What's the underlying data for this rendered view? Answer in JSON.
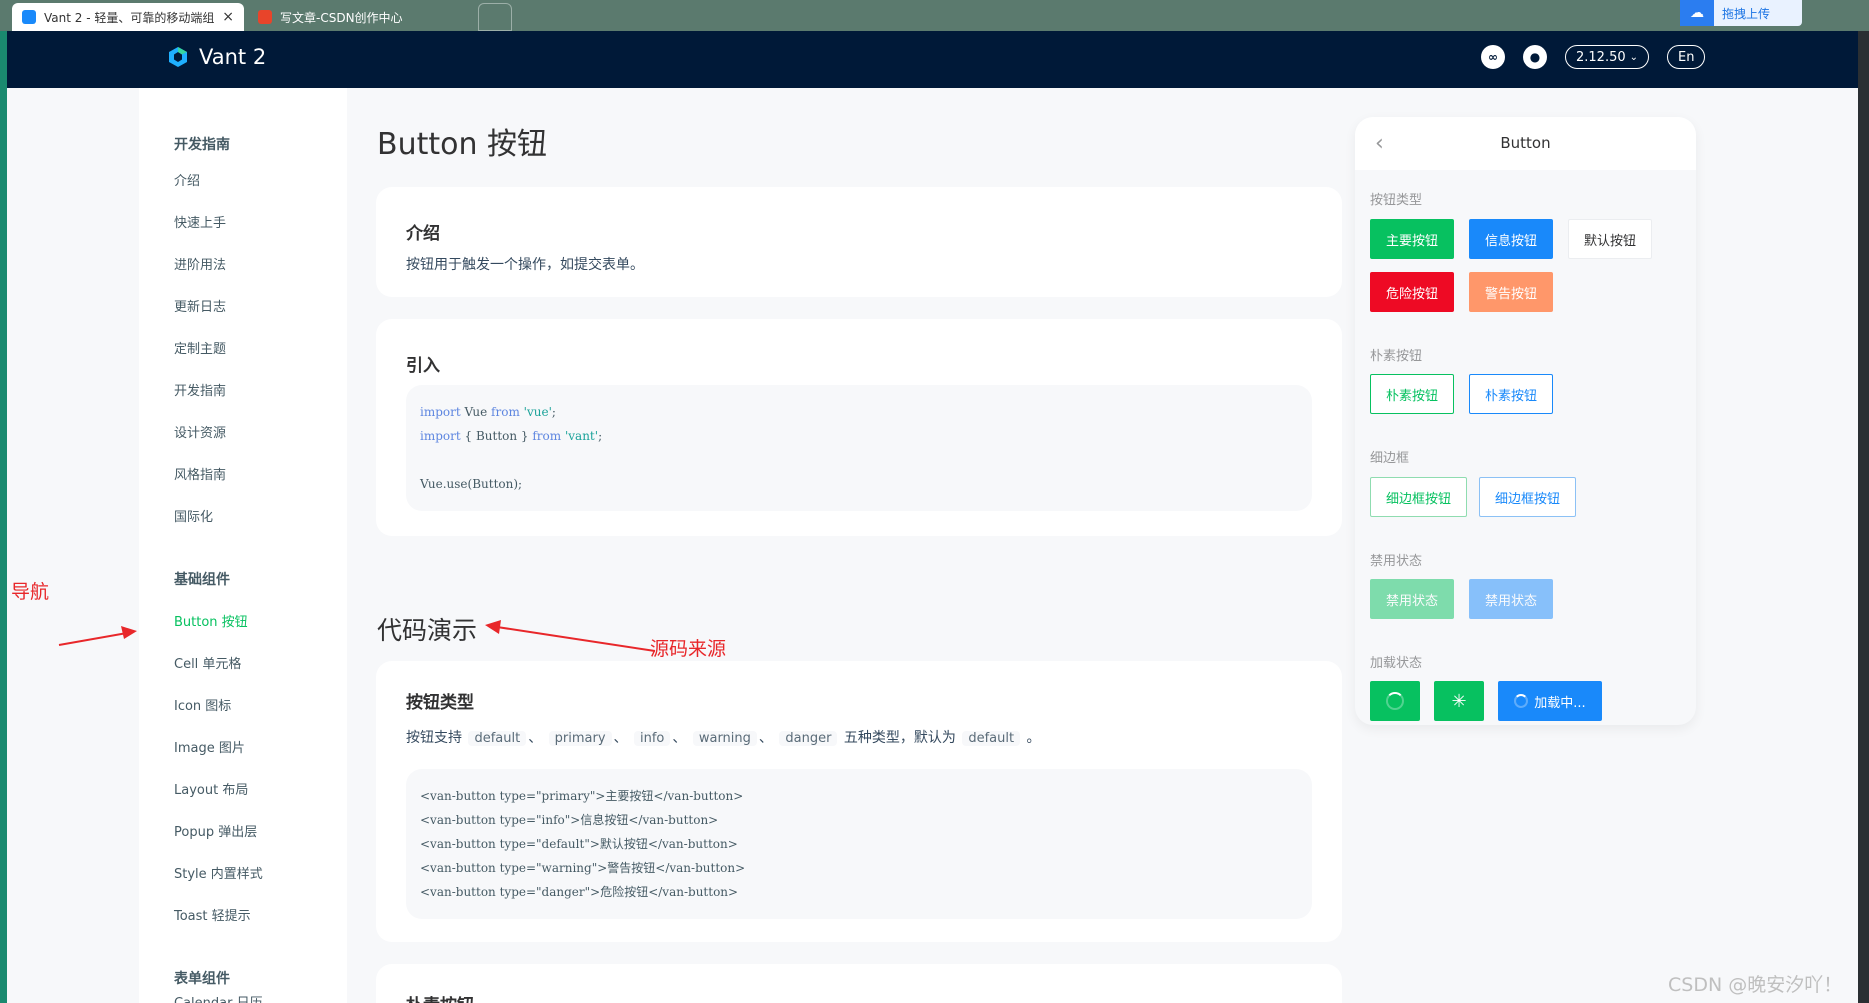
{
  "browser": {
    "tabs": [
      {
        "label": "Vant 2 - 轻量、可靠的移动端组",
        "close": "×",
        "active": true
      },
      {
        "label": "写文章-CSDN创作中心",
        "active": false
      }
    ],
    "upload_label": "拖拽上传"
  },
  "navbar": {
    "brand": "Vant 2",
    "version": "2.12.50",
    "lang": "En"
  },
  "sidebar": {
    "groups": [
      {
        "title": "开发指南",
        "items": [
          "介绍",
          "快速上手",
          "进阶用法",
          "更新日志",
          "定制主题",
          "开发指南",
          "设计资源",
          "风格指南",
          "国际化"
        ]
      },
      {
        "title": "基础组件",
        "items": [
          "Button 按钮",
          "Cell 单元格",
          "Icon 图标",
          "Image 图片",
          "Layout 布局",
          "Popup 弹出层",
          "Style 内置样式",
          "Toast 轻提示"
        ]
      },
      {
        "title": "表单组件",
        "items": [
          "Calendar 日历"
        ]
      }
    ],
    "active_item": "Button 按钮"
  },
  "main": {
    "page_title": "Button 按钮",
    "intro": {
      "title": "介绍",
      "text": "按钮用于触发一个操作，如提交表单。"
    },
    "import": {
      "title": "引入",
      "code": [
        "import Vue from 'vue';",
        "import { Button } from 'vant';",
        "",
        "Vue.use(Button);"
      ]
    },
    "demo_title": "代码演示",
    "types": {
      "title": "按钮类型",
      "text_prefix": "按钮支持",
      "codes": [
        "default",
        "primary",
        "info",
        "warning",
        "danger"
      ],
      "text_suffix": "五种类型，默认为",
      "default_code": "default",
      "end": "。",
      "code": [
        "<van-button type=\"primary\">主要按钮</van-button>",
        "<van-button type=\"info\">信息按钮</van-button>",
        "<van-button type=\"default\">默认按钮</van-button>",
        "<van-button type=\"warning\">警告按钮</van-button>",
        "<van-button type=\"danger\">危险按钮</van-button>"
      ]
    },
    "plain": {
      "title": "朴素按钮"
    }
  },
  "annotations": {
    "nav": "导航",
    "source": "源码来源"
  },
  "phone": {
    "title": "Button",
    "sections": {
      "types": "按钮类型",
      "plain": "朴素按钮",
      "hairline": "细边框",
      "disabled": "禁用状态",
      "loading": "加载状态"
    },
    "buttons": {
      "primary": "主要按钮",
      "info": "信息按钮",
      "default": "默认按钮",
      "danger": "危险按钮",
      "warning": "警告按钮",
      "plain_primary": "朴素按钮",
      "plain_info": "朴素按钮",
      "hair_primary": "细边框按钮",
      "hair_info": "细边框按钮",
      "dis_primary": "禁用状态",
      "dis_info": "禁用状态",
      "loading_text": "加载中..."
    }
  },
  "watermark": "CSDN @晚安汐吖！"
}
